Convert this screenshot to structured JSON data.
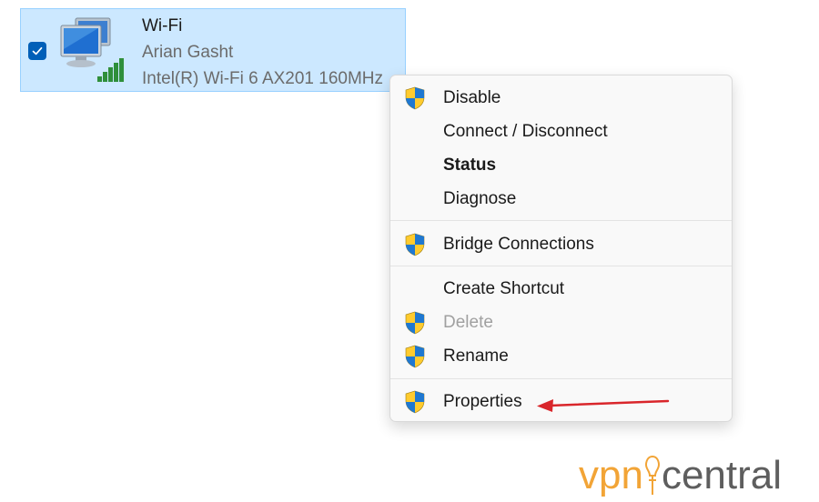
{
  "adapter": {
    "name": "Wi-Fi",
    "user": "Arian Gasht",
    "device": "Intel(R) Wi-Fi 6 AX201 160MHz",
    "selected": true,
    "icon": "network-computer-signal-icon"
  },
  "context_menu": {
    "items": [
      {
        "label": "Disable",
        "icon": "uac-shield-icon",
        "state": "normal"
      },
      {
        "label": "Connect / Disconnect",
        "icon": "",
        "state": "normal"
      },
      {
        "label": "Status",
        "icon": "",
        "state": "bold"
      },
      {
        "label": "Diagnose",
        "icon": "",
        "state": "normal"
      },
      {
        "label": "Bridge Connections",
        "icon": "uac-shield-icon",
        "state": "normal"
      },
      {
        "label": "Create Shortcut",
        "icon": "",
        "state": "normal"
      },
      {
        "label": "Delete",
        "icon": "uac-shield-icon",
        "state": "disabled"
      },
      {
        "label": "Rename",
        "icon": "uac-shield-icon",
        "state": "normal"
      },
      {
        "label": "Properties",
        "icon": "uac-shield-icon",
        "state": "normal"
      }
    ]
  },
  "annotation": {
    "arrow_color": "#d9262b",
    "points_to": "Properties"
  },
  "watermark": {
    "part1": "vpn",
    "part2": "central",
    "color1": "#f2a436",
    "color2": "#5e5e5e"
  }
}
